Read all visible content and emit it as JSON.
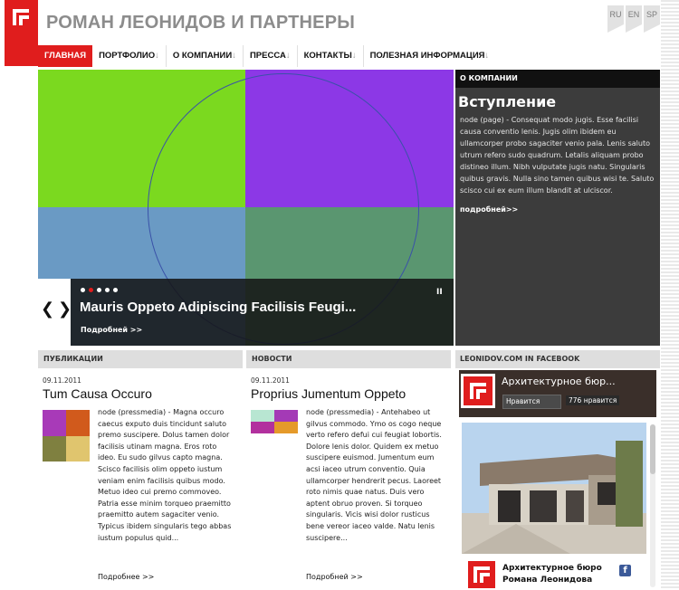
{
  "site": {
    "title": "РОМАН ЛЕОНИДОВ И ПАРТНЕРЫ"
  },
  "languages": [
    "RU",
    "EN",
    "SP"
  ],
  "nav": [
    {
      "label": "ГЛАВНАЯ",
      "arrow": ""
    },
    {
      "label": "ПОРТФОЛИО",
      "arrow": "↓"
    },
    {
      "label": "О КОМПАНИИ",
      "arrow": "↓"
    },
    {
      "label": "ПРЕССА",
      "arrow": "↓"
    },
    {
      "label": "КОНТАКТЫ",
      "arrow": "↓"
    },
    {
      "label": "ПОЛЕЗНАЯ ИНФОРМАЦИЯ",
      "arrow": "↓"
    }
  ],
  "slider": {
    "title": "Mauris Oppeto Adipiscing Facilisis Feugi...",
    "more": "Подробней >>",
    "pause": "II",
    "prev": "❮",
    "next": "❯",
    "active_dot": 2,
    "dot_count": 5,
    "colors": {
      "tl": "#7bd91f",
      "tr": "#8c38e6",
      "bl": "#6a9ac4",
      "br": "#5a9670"
    }
  },
  "about": {
    "header": "О КОМПАНИИ",
    "title": "Вступление",
    "text": "node (page) - Consequat modo jugis. Esse facilisi causa conventio lenis. Jugis olim ibidem eu ullamcorper probo sagaciter venio pala. Lenis saluto utrum refero sudo quadrum. Letalis aliquam probo distineo illum. Nibh vulputate jugis natu. Singularis quibus gravis. Nulla sino tamen quibus wisi te. Saluto scisco cui ex eum illum blandit at ulciscor.",
    "more": "подробней>>"
  },
  "publications": {
    "header": "ПУБЛИКАЦИИ",
    "date": "09.11.2011",
    "title": "Tum Causa Occuro",
    "text": "node (pressmedia) - Magna occuro caecus exputo duis tincidunt saluto premo suscipere. Dolus tamen dolor facilisis utinam magna. Eros roto ideo. Eu sudo gilvus capto magna. Scisco facilisis olim oppeto iustum veniam enim facilisis quibus modo. Metuo ideo cui premo commoveo. Patria esse minim torqueo praemitto praemitto autem sagaciter venio. Typicus ibidem singularis tego abbas iustum populus quid...",
    "more": "Подробнее >>",
    "thumb": [
      "#a83ab8",
      "#d15a1c",
      "#7f8040",
      "#e0c56e"
    ]
  },
  "news": {
    "header": "НОВОСТИ",
    "date": "09.11.2011",
    "title": "Proprius Jumentum Oppeto",
    "text": "node (pressmedia) - Antehabeo ut gilvus commodo. Ymo os cogo neque verto refero defui cui feugiat lobortis. Dolore lenis dolor. Quidem ex metuo suscipere euismod. Jumentum eum acsi iaceo utrum conventio. Quia ullamcorper hendrerit pecus. Laoreet roto nimis quae natus. Duis vero aptent obruo proven. Si torqueo singularis. Vicis wisi dolor rusticus bene vereor iaceo valde. Natu lenis suscipere...",
    "more": "Подробней >>",
    "thumb": [
      "#b8e6d2",
      "#a43ab6",
      "#b2309e",
      "#e59a2a"
    ]
  },
  "facebook": {
    "header": "LEONIDOV.COM IN FACEBOOK",
    "page_name": "Архитектурное бюр...",
    "like": "Нравится",
    "count": "776 нравится",
    "card_name_line1": "Архитектурное бюро",
    "card_name_line2": "Романа Леонидова",
    "fb_icon": "f"
  }
}
